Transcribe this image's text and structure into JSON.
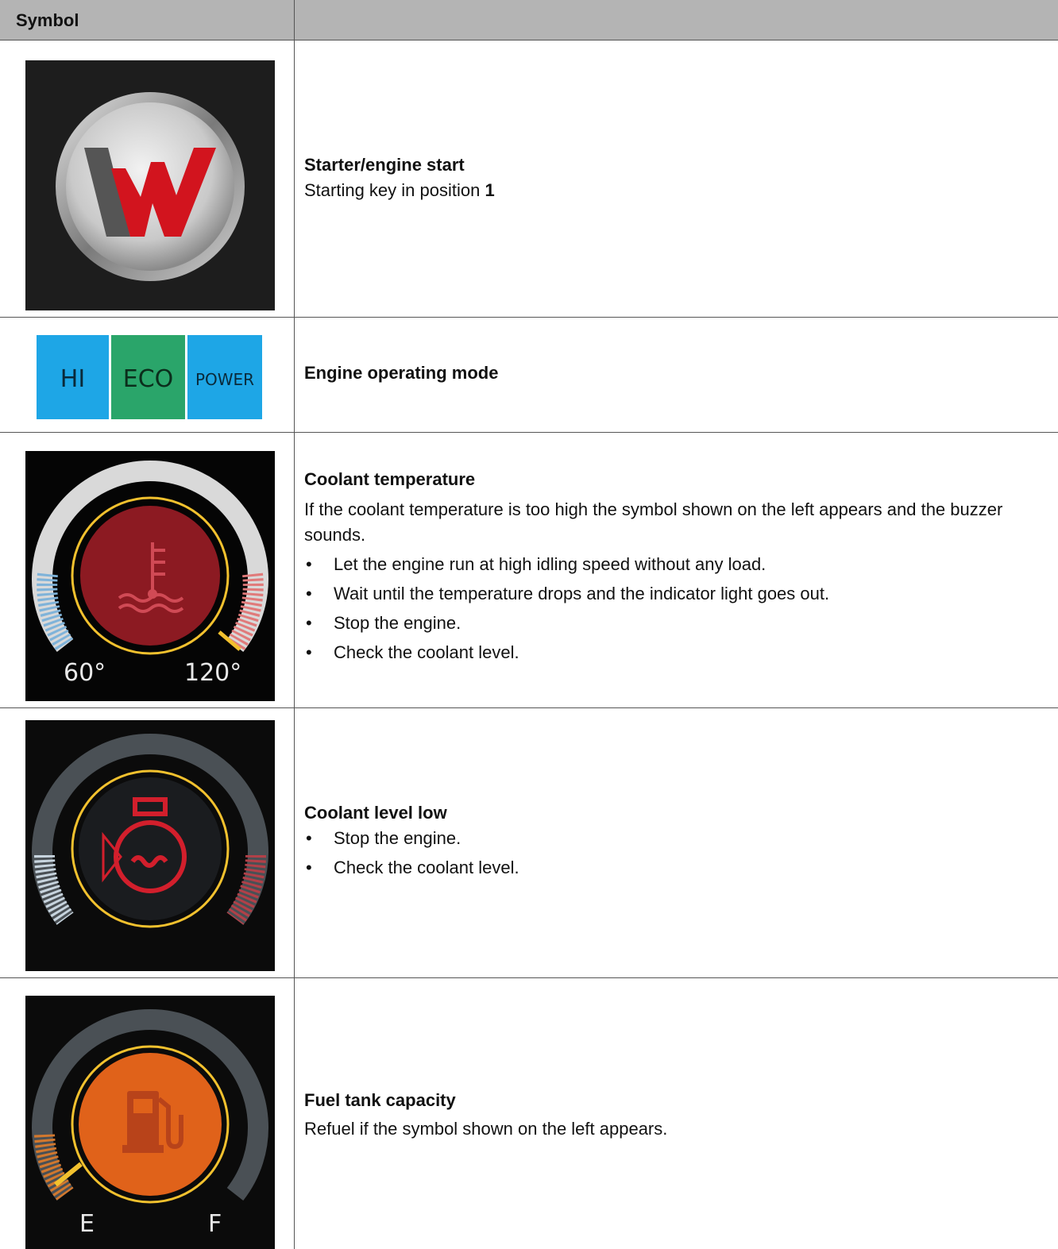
{
  "header": {
    "symbol_label": "Symbol",
    "description_label": ""
  },
  "rows": [
    {
      "icon": "wacker-neuson-logo-icon",
      "title": "Starter/engine start",
      "text_prefix": "Starting key in position ",
      "text_bold": "1"
    },
    {
      "icon": "engine-mode-icon",
      "modes": [
        "HI",
        "ECO",
        "POWER"
      ],
      "mode_colors": [
        "#1ea6e6",
        "#2aa56a",
        "#1ea6e6"
      ],
      "title": "Engine operating mode"
    },
    {
      "icon": "coolant-temperature-icon",
      "gauge_labels": [
        "60°",
        "120°"
      ],
      "title": "Coolant temperature",
      "text": "If the coolant temperature is too high the symbol shown on the left appears and the buzzer sounds.",
      "bullets": [
        "Let the engine run at high idling speed without any load.",
        "Wait until the temperature drops and the indicator light goes out.",
        "Stop the engine.",
        "Check the coolant level."
      ]
    },
    {
      "icon": "coolant-level-low-icon",
      "title": "Coolant level low",
      "bullets": [
        "Stop the engine.",
        "Check the coolant level."
      ]
    },
    {
      "icon": "fuel-pump-icon",
      "gauge_labels": [
        "E",
        "F"
      ],
      "title": "Fuel tank capacity",
      "text": "Refuel if the symbol shown on the left appears."
    }
  ],
  "colors": {
    "header_bg": "#b4b4b4",
    "warning_red": "#c8102e",
    "fuel_orange": "#e0621a",
    "ring_yellow": "#f2c12e"
  }
}
